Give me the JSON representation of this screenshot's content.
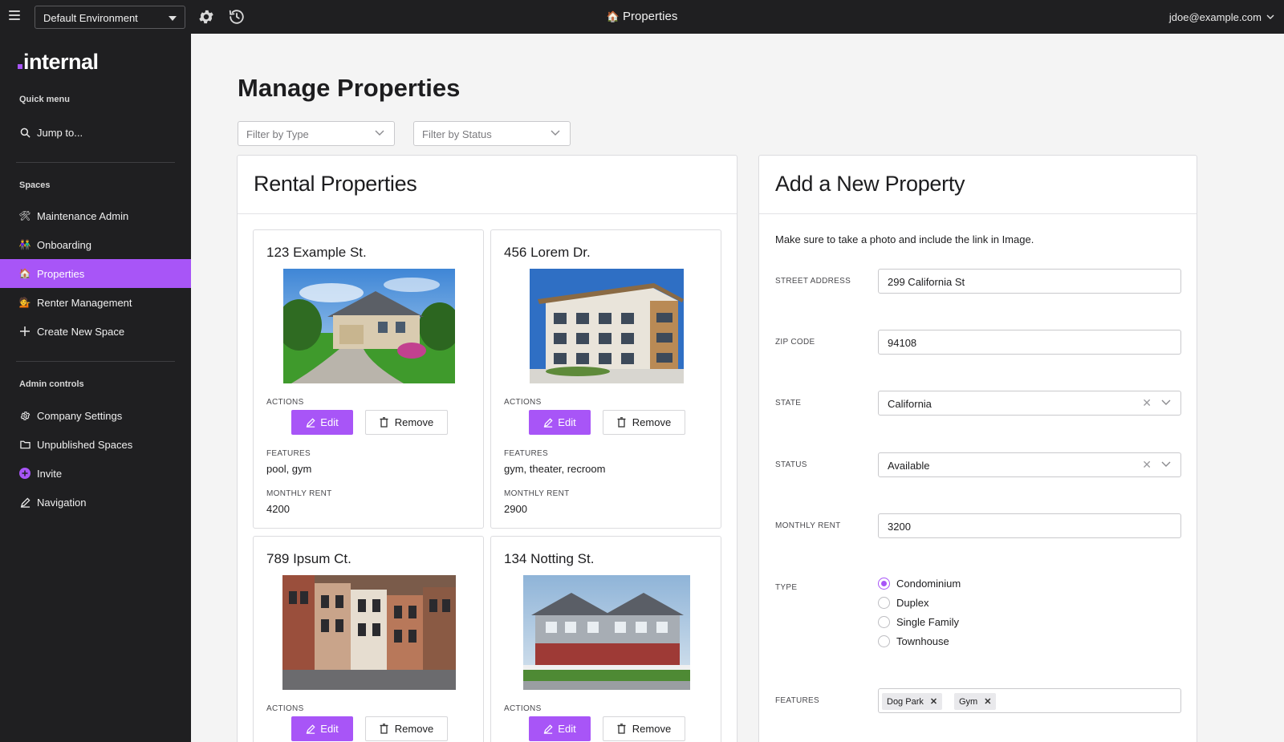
{
  "topbar": {
    "environment": "Default Environment",
    "title": "Properties",
    "title_emoji": "🏠",
    "user": "jdoe@example.com"
  },
  "sidebar": {
    "logo": "internal",
    "quick_menu_heading": "Quick menu",
    "jump_to": "Jump to...",
    "spaces_heading": "Spaces",
    "spaces": [
      {
        "emoji": "🛠",
        "label": "Maintenance Admin"
      },
      {
        "emoji": "👫",
        "label": "Onboarding"
      },
      {
        "emoji": "🏠",
        "label": "Properties"
      },
      {
        "emoji": "💁",
        "label": "Renter Management"
      }
    ],
    "create_space": "Create New Space",
    "admin_heading": "Admin controls",
    "admin_items": [
      "Company Settings",
      "Unpublished Spaces",
      "Invite",
      "Navigation"
    ]
  },
  "main": {
    "title": "Manage Properties",
    "filter_type_placeholder": "Filter by Type",
    "filter_status_placeholder": "Filter by Status"
  },
  "rentals": {
    "panel_title": "Rental Properties",
    "actions_label": "ACTIONS",
    "edit_label": "Edit",
    "remove_label": "Remove",
    "features_label": "FEATURES",
    "rent_label": "MONTHLY RENT",
    "cards": [
      {
        "address": "123 Example St.",
        "features": "pool, gym",
        "rent": "4200"
      },
      {
        "address": "456 Lorem Dr.",
        "features": "gym, theater, recroom",
        "rent": "2900"
      },
      {
        "address": "789 Ipsum Ct."
      },
      {
        "address": "134 Notting St."
      }
    ]
  },
  "form": {
    "panel_title": "Add a New Property",
    "note": "Make sure to take a photo and include the link in Image.",
    "street_label": "STREET ADDRESS",
    "street_value": "299 California St",
    "zip_label": "ZIP CODE",
    "zip_value": "94108",
    "state_label": "STATE",
    "state_value": "California",
    "status_label": "STATUS",
    "status_value": "Available",
    "rent_label": "MONTHLY RENT",
    "rent_value": "3200",
    "type_label": "TYPE",
    "type_options": [
      "Condominium",
      "Duplex",
      "Single Family",
      "Townhouse"
    ],
    "type_selected": "Condominium",
    "features_label": "FEATURES",
    "feature_tags": [
      "Dog Park",
      "Gym"
    ]
  },
  "colors": {
    "accent": "#a855f7",
    "chrome": "#1f1f21",
    "page_bg": "#f4f4f4"
  }
}
